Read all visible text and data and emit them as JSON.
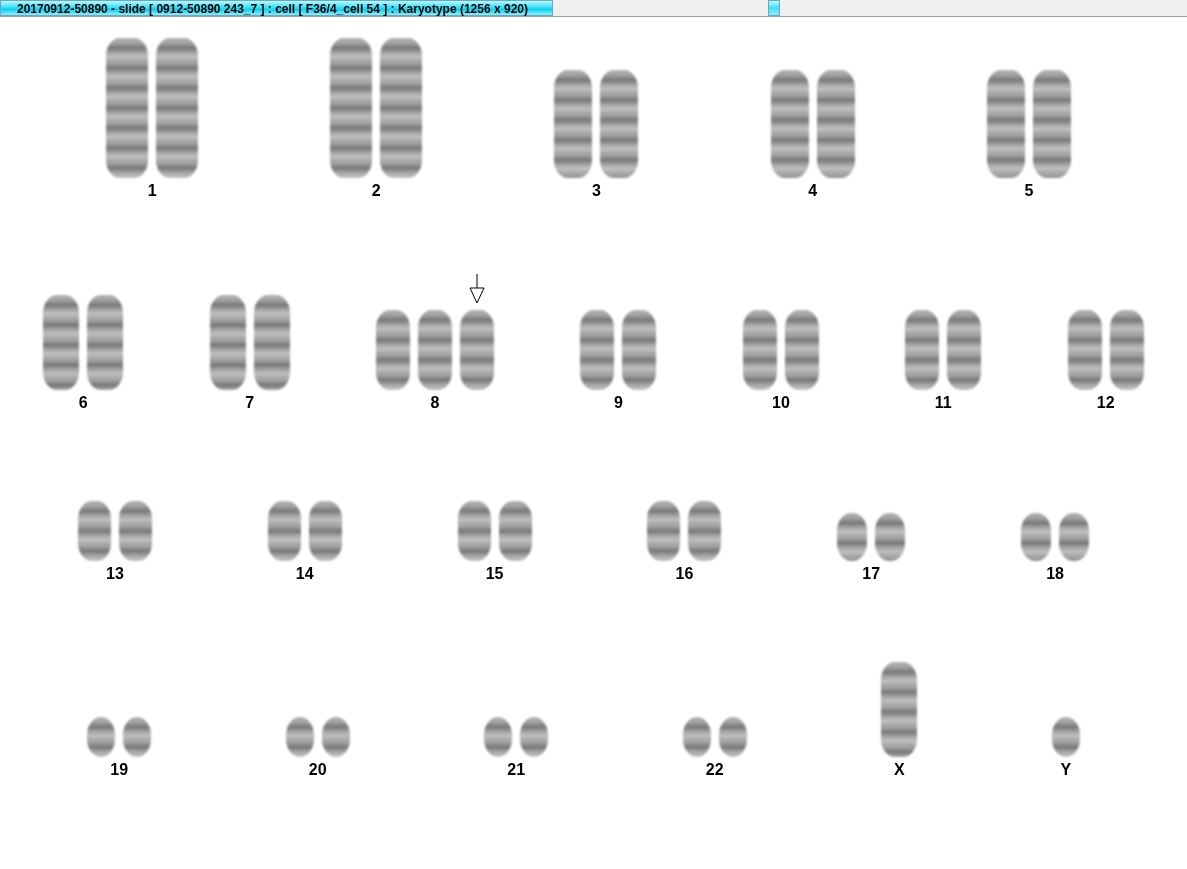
{
  "window": {
    "title": "20170912-50890 - slide [ 0912-50890 243_7 ] : cell [ F36/4_cell 54 ] : Karyotype  (1256 x 920)"
  },
  "rows": [
    {
      "groups": [
        {
          "label": "1",
          "chromosomes": [
            {
              "kind": "long",
              "marked": false
            },
            {
              "kind": "long",
              "marked": false
            }
          ]
        },
        {
          "label": "2",
          "chromosomes": [
            {
              "kind": "long",
              "marked": false
            },
            {
              "kind": "long",
              "marked": false
            }
          ]
        },
        {
          "label": "3",
          "chromosomes": [
            {
              "kind": "medium_long",
              "marked": false
            },
            {
              "kind": "medium_long",
              "marked": false
            }
          ]
        },
        {
          "label": "4",
          "chromosomes": [
            {
              "kind": "medium_long",
              "marked": false
            },
            {
              "kind": "medium_long",
              "marked": false
            }
          ]
        },
        {
          "label": "5",
          "chromosomes": [
            {
              "kind": "medium_long",
              "marked": false
            },
            {
              "kind": "medium_long",
              "marked": false
            }
          ]
        }
      ]
    },
    {
      "groups": [
        {
          "label": "6",
          "chromosomes": [
            {
              "kind": "medium",
              "marked": false
            },
            {
              "kind": "medium",
              "marked": false
            }
          ]
        },
        {
          "label": "7",
          "chromosomes": [
            {
              "kind": "medium",
              "marked": false
            },
            {
              "kind": "medium",
              "marked": false
            }
          ]
        },
        {
          "label": "8",
          "chromosomes": [
            {
              "kind": "medium_short",
              "marked": false
            },
            {
              "kind": "medium_short",
              "marked": false
            },
            {
              "kind": "medium_short",
              "marked": true
            }
          ]
        },
        {
          "label": "9",
          "chromosomes": [
            {
              "kind": "medium_short",
              "marked": false
            },
            {
              "kind": "medium_short",
              "marked": false
            }
          ]
        },
        {
          "label": "10",
          "chromosomes": [
            {
              "kind": "medium_short",
              "marked": false
            },
            {
              "kind": "medium_short",
              "marked": false
            }
          ]
        },
        {
          "label": "11",
          "chromosomes": [
            {
              "kind": "medium_short",
              "marked": false
            },
            {
              "kind": "medium_short",
              "marked": false
            }
          ]
        },
        {
          "label": "12",
          "chromosomes": [
            {
              "kind": "medium_short",
              "marked": false
            },
            {
              "kind": "medium_short",
              "marked": false
            }
          ]
        }
      ]
    },
    {
      "groups": [
        {
          "label": "13",
          "chromosomes": [
            {
              "kind": "short",
              "marked": false
            },
            {
              "kind": "short",
              "marked": false
            }
          ]
        },
        {
          "label": "14",
          "chromosomes": [
            {
              "kind": "short",
              "marked": false
            },
            {
              "kind": "short",
              "marked": false
            }
          ]
        },
        {
          "label": "15",
          "chromosomes": [
            {
              "kind": "short",
              "marked": false
            },
            {
              "kind": "short",
              "marked": false
            }
          ]
        },
        {
          "label": "16",
          "chromosomes": [
            {
              "kind": "short",
              "marked": false
            },
            {
              "kind": "short",
              "marked": false
            }
          ]
        },
        {
          "label": "17",
          "chromosomes": [
            {
              "kind": "small",
              "marked": false
            },
            {
              "kind": "small",
              "marked": false
            }
          ]
        },
        {
          "label": "18",
          "chromosomes": [
            {
              "kind": "small",
              "marked": false
            },
            {
              "kind": "small",
              "marked": false
            }
          ]
        }
      ]
    },
    {
      "groups": [
        {
          "label": "19",
          "chromosomes": [
            {
              "kind": "tiny",
              "marked": false
            },
            {
              "kind": "tiny",
              "marked": false
            }
          ]
        },
        {
          "label": "20",
          "chromosomes": [
            {
              "kind": "tiny",
              "marked": false
            },
            {
              "kind": "tiny",
              "marked": false
            }
          ]
        },
        {
          "label": "21",
          "chromosomes": [
            {
              "kind": "tiny",
              "marked": false
            },
            {
              "kind": "tiny",
              "marked": false
            }
          ]
        },
        {
          "label": "22",
          "chromosomes": [
            {
              "kind": "tiny",
              "marked": false
            },
            {
              "kind": "tiny",
              "marked": false
            }
          ]
        },
        {
          "label": "X",
          "chromosomes": [
            {
              "kind": "medium",
              "marked": false
            }
          ]
        },
        {
          "label": "Y",
          "chromosomes": [
            {
              "kind": "tiny",
              "marked": false
            }
          ]
        }
      ]
    }
  ]
}
